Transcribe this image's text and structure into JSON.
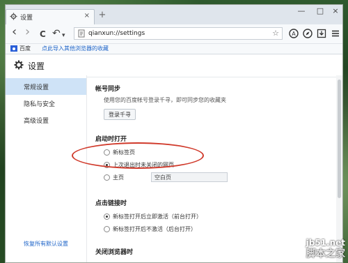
{
  "tab": {
    "title": "设置",
    "close": "×",
    "new_tab": "+"
  },
  "window_controls": {
    "minimize": "—",
    "maximize": "□",
    "close": "×"
  },
  "toolbar": {
    "back": "‹",
    "forward": "›",
    "reload": "C",
    "undo": "↶",
    "undo_dropdown": "▾"
  },
  "address": {
    "url": "qianxun://settings",
    "star": "☆"
  },
  "bookmarks": {
    "baidu": "百度",
    "import_link": "点此导入其他浏览器的收藏"
  },
  "page": {
    "title": "设置"
  },
  "sidebar": {
    "items": [
      {
        "label": "常规设置",
        "active": true
      },
      {
        "label": "隐私与安全",
        "active": false
      },
      {
        "label": "高级设置",
        "active": false
      }
    ],
    "reset": "恢复所有默认设置"
  },
  "account": {
    "title": "帐号同步",
    "desc": "使用您的百度帐号登录千寻，即可同步您的收藏夹",
    "login_button": "登录千寻"
  },
  "startup": {
    "title": "启动时打开",
    "options": [
      {
        "label": "新标签页",
        "selected": false
      },
      {
        "label": "上次退出时未关闭的网页",
        "selected": true
      },
      {
        "label": "主页",
        "selected": false
      }
    ],
    "home_value": "空白页"
  },
  "link_click": {
    "title": "点击链接时",
    "options": [
      {
        "label": "新标签打开后立即激活（前台打开）",
        "selected": true
      },
      {
        "label": "新标签打开后不激活（后台打开）",
        "selected": false
      }
    ]
  },
  "close_browser": {
    "title": "关闭浏览器时"
  },
  "watermark": {
    "top": "jb51.net",
    "bottom": "脚本之家"
  },
  "colors": {
    "accent": "#1e64c8",
    "active_bg": "#cfe3f7",
    "annotation": "#d0392a"
  }
}
